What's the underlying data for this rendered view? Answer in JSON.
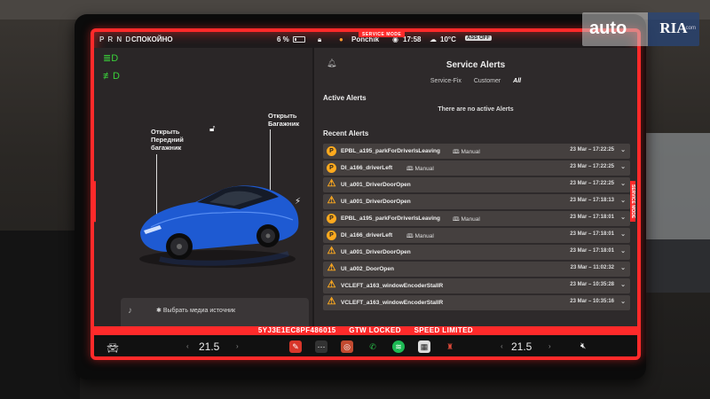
{
  "status_bar": {
    "prnd": "P R N D",
    "drive_mode": "СПОКОЙНО",
    "battery": "6 %",
    "service_mode": "SERVICE MODE",
    "profile_name": "Ponchik",
    "clock": "17:58",
    "temperature": "10°C",
    "airbag": "ASS OFF"
  },
  "car_panel": {
    "frunk_label": "Открыть Передний багажник",
    "trunk_label": "Открыть Багажник",
    "service_mode_side": "SERVICE MODE"
  },
  "media": {
    "source_label": "Выбрать медиа источник"
  },
  "alerts": {
    "title": "Service Alerts",
    "tabs": [
      {
        "label": "Service-Fix",
        "active": false
      },
      {
        "label": "Customer",
        "active": false
      },
      {
        "label": "All",
        "active": true
      }
    ],
    "active_heading": "Active Alerts",
    "no_active": "There are no active Alerts",
    "recent_heading": "Recent Alerts",
    "service_mode_side": "SERVICE MODE",
    "recent": [
      {
        "icon": "P",
        "shape": "circle",
        "name": "EPBL_a195_parkForDriverIsLeaving",
        "manual": "Manual",
        "time": "23 Mar – 17:22:25"
      },
      {
        "icon": "P",
        "shape": "circle",
        "name": "DI_a166_driverLeft",
        "manual": "Manual",
        "time": "23 Mar – 17:22:25"
      },
      {
        "icon": "!",
        "shape": "triangle",
        "name": "UI_a001_DriverDoorOpen",
        "manual": "",
        "time": "23 Mar – 17:22:25"
      },
      {
        "icon": "!",
        "shape": "triangle",
        "name": "UI_a001_DriverDoorOpen",
        "manual": "",
        "time": "23 Mar – 17:18:13"
      },
      {
        "icon": "P",
        "shape": "circle",
        "name": "EPBL_a195_parkForDriverIsLeaving",
        "manual": "Manual",
        "time": "23 Mar – 17:18:01"
      },
      {
        "icon": "P",
        "shape": "circle",
        "name": "DI_a166_driverLeft",
        "manual": "Manual",
        "time": "23 Mar – 17:18:01"
      },
      {
        "icon": "!",
        "shape": "triangle",
        "name": "UI_a001_DriverDoorOpen",
        "manual": "",
        "time": "23 Mar – 17:18:01"
      },
      {
        "icon": "!",
        "shape": "triangle",
        "name": "UI_a002_DoorOpen",
        "manual": "",
        "time": "23 Mar – 11:02:32"
      },
      {
        "icon": "!",
        "shape": "triangle",
        "name": "VCLEFT_a163_windowEncoderStallR",
        "manual": "",
        "time": "23 Mar – 10:35:28"
      },
      {
        "icon": "!",
        "shape": "triangle",
        "name": "VCLEFT_a163_windowEncoderStallR",
        "manual": "",
        "time": "23 Mar – 10:35:16"
      }
    ]
  },
  "banner": {
    "vin": "5YJ3E1EC8PF486015",
    "gtw": "GTW LOCKED",
    "speed": "SPEED LIMITED"
  },
  "dock": {
    "temp_left": "21.5",
    "temp_right": "21.5"
  },
  "watermark": {
    "auto": "auto",
    "ria": "RIA",
    "dotcom": ".com"
  },
  "colors": {
    "service_red": "#ff2a2a",
    "alert_amber": "#ffaa1e",
    "car_blue": "#1e5ad2",
    "indicator_green": "#3ad23a"
  }
}
